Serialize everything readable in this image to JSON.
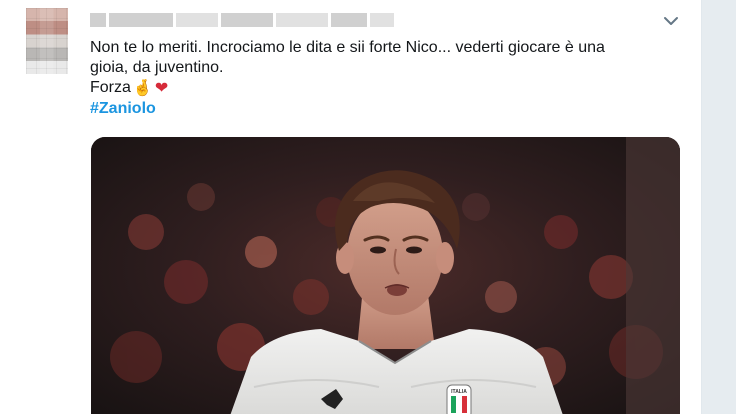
{
  "tweet": {
    "text_line_1": "Non te lo meriti. Incrociamo le dita e sii forte Nico... vederti giocare è una",
    "text_line_2": "gioia, da juventino.",
    "text_line_3": "Forza",
    "hashtag": "#Zaniolo"
  },
  "icons": {
    "menu": "chevron-down-icon",
    "emoji_1": "crossed-fingers-icon",
    "emoji_2": "red-heart-icon"
  },
  "media": {
    "jersey_text": "ITALIA"
  },
  "colors": {
    "hashtag": "#1b95e0",
    "text": "#14171a",
    "muted": "#657786",
    "background": "#e6ecf0"
  }
}
